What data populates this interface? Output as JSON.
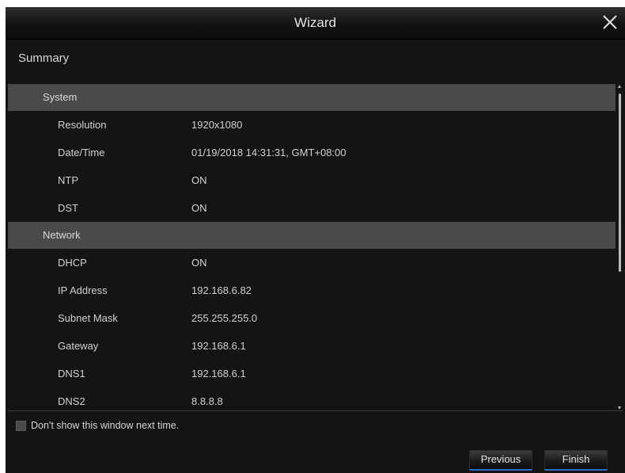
{
  "window": {
    "title": "Wizard",
    "section_title": "Summary"
  },
  "summary": {
    "groups": [
      {
        "header": "System",
        "rows": [
          {
            "label": "Resolution",
            "value": "1920x1080"
          },
          {
            "label": "Date/Time",
            "value": "01/19/2018 14:31:31, GMT+08:00"
          },
          {
            "label": "NTP",
            "value": "ON"
          },
          {
            "label": "DST",
            "value": "ON"
          }
        ]
      },
      {
        "header": "Network",
        "rows": [
          {
            "label": "DHCP",
            "value": "ON"
          },
          {
            "label": "IP Address",
            "value": "192.168.6.82"
          },
          {
            "label": "Subnet Mask",
            "value": "255.255.255.0"
          },
          {
            "label": "Gateway",
            "value": "192.168.6.1"
          },
          {
            "label": "DNS1",
            "value": "192.168.6.1"
          },
          {
            "label": "DNS2",
            "value": "8.8.8.8"
          }
        ]
      }
    ]
  },
  "footer": {
    "checkbox_label": "Don't show this window next time.",
    "checkbox_checked": false,
    "previous_label": "Previous",
    "finish_label": "Finish"
  },
  "icons": {
    "close": "close-icon",
    "checkbox": "checkbox-icon"
  },
  "colors": {
    "background": "#141414",
    "group_header": "#4a4a4a",
    "text": "#d2d2d2",
    "button_accent": "#2f6bc9"
  }
}
